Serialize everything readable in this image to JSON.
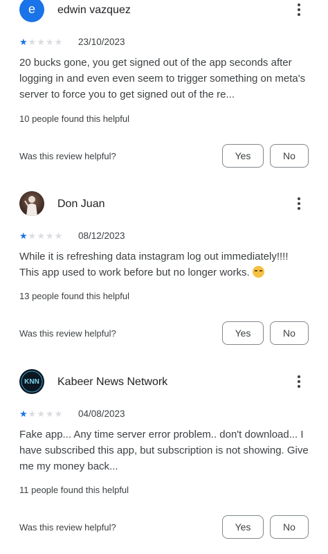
{
  "reviews": [
    {
      "avatar_letter": "e",
      "avatar_icon": "letter-avatar",
      "name": "edwin vazquez",
      "rating": 1,
      "date": "23/10/2023",
      "text": "20 bucks gone, you get signed out of the app seconds after logging in and even even seem to trigger something on meta's server to force you to get signed out of the re...",
      "helpful_count": "10 people found this helpful",
      "helpful_question": "Was this review helpful?",
      "yes_label": "Yes",
      "no_label": "No"
    },
    {
      "avatar_icon": "statue-photo-avatar",
      "name": "Don Juan",
      "rating": 1,
      "date": "08/12/2023",
      "text": "While it is refreshing data instagram log out immediately!!!! This app used to work before but no longer works.",
      "text_emoji": "sad-face-emoji",
      "helpful_count": "13 people found this helpful",
      "helpful_question": "Was this review helpful?",
      "yes_label": "Yes",
      "no_label": "No"
    },
    {
      "avatar_text": "KNN",
      "avatar_icon": "knn-logo-avatar",
      "name": "Kabeer News Network",
      "rating": 1,
      "date": "04/08/2023",
      "text": "Fake app... Any time server error problem.. don't download... I have subscribed this app, but subscription is not showing. Give me my money back...",
      "helpful_count": "11 people found this helpful",
      "helpful_question": "Was this review helpful?",
      "yes_label": "Yes",
      "no_label": "No"
    }
  ],
  "colors": {
    "accent": "#1a73e8",
    "star_empty": "#dadce0",
    "text": "#3c4043",
    "button_border": "#80868b"
  }
}
